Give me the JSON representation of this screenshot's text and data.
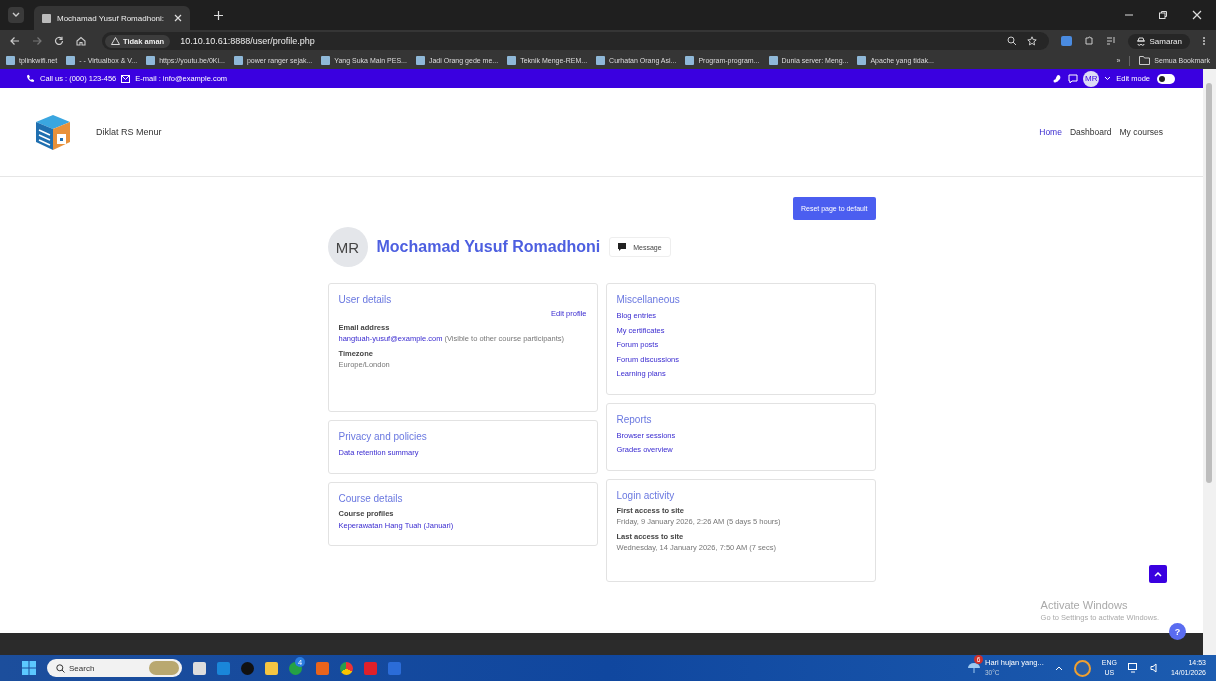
{
  "browser": {
    "tabs": [
      {
        "title": "Mochamad Yusuf Romadhoni:",
        "selected": true
      }
    ],
    "address": {
      "security": "Tidak aman",
      "url": "10.10.10.61:8888/user/profile.php"
    },
    "profile_label": "Samaran",
    "bookmarks": [
      {
        "label": "tplinkwifi.net"
      },
      {
        "label": "- - Virtualbox & V..."
      },
      {
        "label": "https://youtu.be/0Ki..."
      },
      {
        "label": "power ranger sejak..."
      },
      {
        "label": "Yang Suka Main PES..."
      },
      {
        "label": "Jadi Orang gede me..."
      },
      {
        "label": "Teknik Menge-REM..."
      },
      {
        "label": "Curhatan Orang Asi..."
      },
      {
        "label": "Program-program..."
      },
      {
        "label": "Dunia server: Meng..."
      },
      {
        "label": "Apache yang tidak..."
      }
    ],
    "bookmarks_more": "»",
    "all_bookmarks": "Semua Bookmark"
  },
  "top_bar": {
    "phone": "Call us : (000) 123-456",
    "email": "E-mail : info@example.com",
    "avatar": "MR",
    "edit_mode": {
      "label": "Edit mode",
      "on": false
    }
  },
  "header": {
    "site_name": "Diklat RS Menur",
    "nav": [
      {
        "label": "Home",
        "selected": true
      },
      {
        "label": "Dashboard",
        "selected": false
      },
      {
        "label": "My courses",
        "selected": false
      }
    ]
  },
  "reset_button": "Reset page to default",
  "profile": {
    "initials": "MR",
    "name": "Mochamad Yusuf Romadhoni",
    "message_button": "Message"
  },
  "columns": [
    [
      {
        "title": "User details",
        "action": "Edit profile",
        "items": [
          {
            "kind": "label",
            "text": "Email address"
          },
          {
            "kind": "link_note",
            "text": "hangtuah-yusuf@example.com",
            "note": "(Visible to other course participants)"
          },
          {
            "kind": "label",
            "text": "Timezone"
          },
          {
            "kind": "text",
            "text": "Europe/London"
          }
        ]
      },
      {
        "title": "Privacy and policies",
        "items": [
          {
            "kind": "link",
            "text": "Data retention summary"
          }
        ]
      },
      {
        "title": "Course details",
        "items": [
          {
            "kind": "label",
            "text": "Course profiles"
          },
          {
            "kind": "link",
            "text": "Keperawatan Hang Tuah (Januari)"
          }
        ]
      }
    ],
    [
      {
        "title": "Miscellaneous",
        "items": [
          {
            "kind": "link",
            "text": "Blog entries"
          },
          {
            "kind": "link",
            "text": "My certificates"
          },
          {
            "kind": "link",
            "text": "Forum posts"
          },
          {
            "kind": "link",
            "text": "Forum discussions"
          },
          {
            "kind": "link",
            "text": "Learning plans"
          }
        ]
      },
      {
        "title": "Reports",
        "items": [
          {
            "kind": "link",
            "text": "Browser sessions"
          },
          {
            "kind": "link",
            "text": "Grades overview"
          }
        ]
      },
      {
        "title": "Login activity",
        "items": [
          {
            "kind": "label",
            "text": "First access to site"
          },
          {
            "kind": "text",
            "text": "Friday, 9 January 2026, 2:26 AM  (5 days 5 hours)"
          },
          {
            "kind": "label",
            "text": "Last access to site"
          },
          {
            "kind": "text",
            "text": "Wednesday, 14 January 2026, 7:50 AM  (7 secs)"
          }
        ]
      }
    ]
  ],
  "activation": {
    "title": "Activate Windows",
    "text": "Go to Settings to activate Windows."
  },
  "help_button": "?",
  "taskbar": {
    "search_placeholder": "Search",
    "whatsapp_badge": "4",
    "weather": {
      "badge": "6",
      "text": "Hari hujan yang...",
      "temp": "30°C"
    },
    "language": "ENG",
    "region": "US",
    "time": "14:53",
    "date": "14/01/2026"
  }
}
